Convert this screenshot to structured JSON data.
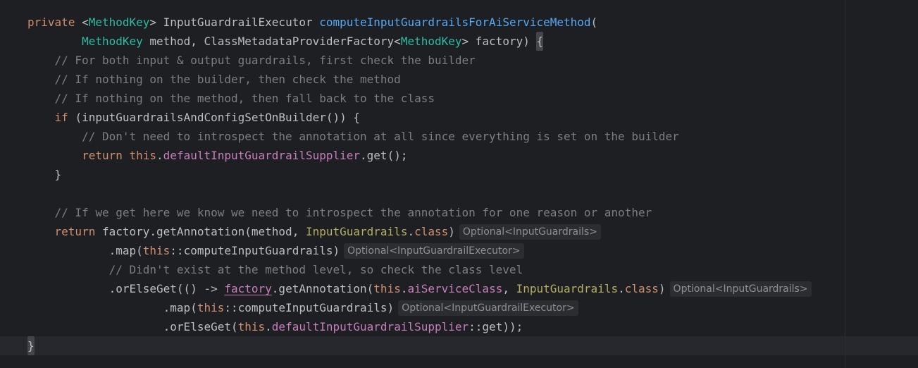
{
  "editor": {
    "lines": [
      {
        "indent": "",
        "tokens": [
          {
            "t": "private ",
            "c": "kw"
          },
          {
            "t": "<",
            "c": "cls"
          },
          {
            "t": "MethodKey",
            "c": "type"
          },
          {
            "t": "> InputGuardrailExecutor ",
            "c": "cls"
          },
          {
            "t": "computeInputGuardrailsForAiServiceMethod",
            "c": "fn-decl"
          },
          {
            "t": "(",
            "c": "cls"
          }
        ]
      },
      {
        "indent": "        ",
        "tokens": [
          {
            "t": "MethodKey",
            "c": "type"
          },
          {
            "t": " method, ClassMetadataProviderFactory<",
            "c": "cls"
          },
          {
            "t": "MethodKey",
            "c": "type"
          },
          {
            "t": "> factory) ",
            "c": "cls"
          },
          {
            "t": "{",
            "c": "cls brace-hl"
          }
        ]
      },
      {
        "indent": "    ",
        "tokens": [
          {
            "t": "// For both input & output guardrails, first check the builder",
            "c": "cmt"
          }
        ]
      },
      {
        "indent": "    ",
        "tokens": [
          {
            "t": "// If nothing on the builder, then check the method",
            "c": "cmt"
          }
        ]
      },
      {
        "indent": "    ",
        "tokens": [
          {
            "t": "// If nothing on the method, then fall back to the class",
            "c": "cmt"
          }
        ]
      },
      {
        "indent": "    ",
        "tokens": [
          {
            "t": "if ",
            "c": "kw"
          },
          {
            "t": "(inputGuardrailsAndConfigSetOnBuilder()) {",
            "c": "cls"
          }
        ]
      },
      {
        "indent": "        ",
        "tokens": [
          {
            "t": "// Don't need to introspect the annotation at all since everything is set on the builder",
            "c": "cmt"
          }
        ]
      },
      {
        "indent": "        ",
        "tokens": [
          {
            "t": "return ",
            "c": "kw"
          },
          {
            "t": "this",
            "c": "kw"
          },
          {
            "t": ".",
            "c": "cls"
          },
          {
            "t": "defaultInputGuardrailSupplier",
            "c": "field"
          },
          {
            "t": ".get();",
            "c": "cls"
          }
        ]
      },
      {
        "indent": "    ",
        "tokens": [
          {
            "t": "}",
            "c": "cls"
          }
        ]
      },
      {
        "indent": "",
        "tokens": []
      },
      {
        "indent": "    ",
        "tokens": [
          {
            "t": "// If we get here we know we need to introspect the annotation for one reason or another",
            "c": "cmt"
          }
        ]
      },
      {
        "indent": "    ",
        "tokens": [
          {
            "t": "return ",
            "c": "kw"
          },
          {
            "t": "factory.getAnnotation(method, ",
            "c": "cls"
          },
          {
            "t": "InputGuardrails",
            "c": "ann"
          },
          {
            "t": ".",
            "c": "cls"
          },
          {
            "t": "class",
            "c": "kw"
          },
          {
            "t": ")",
            "c": "cls"
          }
        ],
        "hint": "Optional<InputGuardrails>"
      },
      {
        "indent": "            ",
        "tokens": [
          {
            "t": ".map(",
            "c": "cls"
          },
          {
            "t": "this",
            "c": "kw"
          },
          {
            "t": "::computeInputGuardrails)",
            "c": "cls"
          }
        ],
        "hint": "Optional<InputGuardrailExecutor>"
      },
      {
        "indent": "            ",
        "tokens": [
          {
            "t": "// Didn't exist at the method level, so check the class level",
            "c": "cmt"
          }
        ]
      },
      {
        "indent": "            ",
        "tokens": [
          {
            "t": ".orElseGet(() -> ",
            "c": "cls"
          },
          {
            "t": "factory",
            "c": "field param-underline"
          },
          {
            "t": ".getAnnotation(",
            "c": "cls"
          },
          {
            "t": "this",
            "c": "kw"
          },
          {
            "t": ".",
            "c": "cls"
          },
          {
            "t": "aiServiceClass",
            "c": "field"
          },
          {
            "t": ", ",
            "c": "cls"
          },
          {
            "t": "InputGuardrails",
            "c": "ann"
          },
          {
            "t": ".",
            "c": "cls"
          },
          {
            "t": "class",
            "c": "kw"
          },
          {
            "t": ")",
            "c": "cls"
          }
        ],
        "hint": "Optional<InputGuardrails>"
      },
      {
        "indent": "                    ",
        "tokens": [
          {
            "t": ".map(",
            "c": "cls"
          },
          {
            "t": "this",
            "c": "kw"
          },
          {
            "t": "::computeInputGuardrails)",
            "c": "cls"
          }
        ],
        "hint": "Optional<InputGuardrailExecutor>"
      },
      {
        "indent": "                    ",
        "tokens": [
          {
            "t": ".orElseGet(",
            "c": "cls"
          },
          {
            "t": "this",
            "c": "kw"
          },
          {
            "t": ".",
            "c": "cls"
          },
          {
            "t": "defaultInputGuardrailSupplier",
            "c": "field"
          },
          {
            "t": "::get));",
            "c": "cls"
          }
        ]
      },
      {
        "indent": "",
        "tokens": [
          {
            "t": "}",
            "c": "cls brace-hl"
          }
        ]
      }
    ]
  },
  "colors": {
    "background": "#1e1f22",
    "keyword": "#cf8e6d",
    "type": "#2fbaa3",
    "method_declaration": "#56a8f5",
    "field": "#c77dbb",
    "comment": "#7a7e85",
    "annotation_class": "#b3ae60",
    "hint_background": "#2b2d30"
  }
}
